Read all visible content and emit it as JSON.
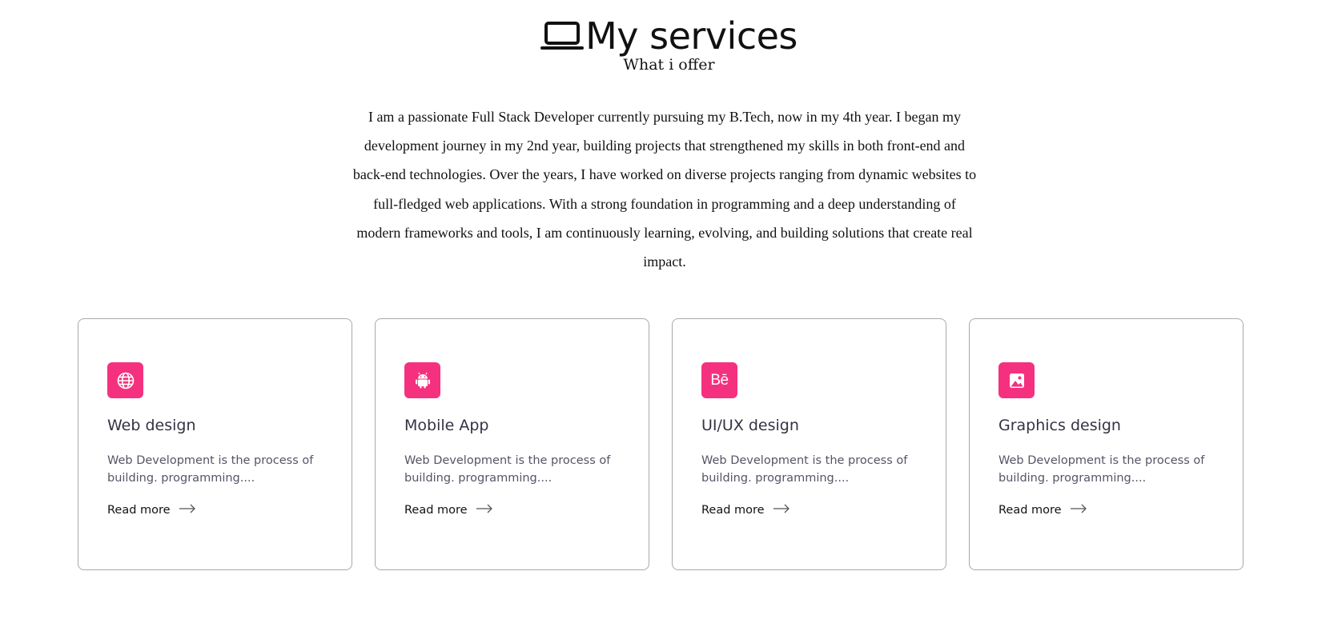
{
  "header": {
    "title": "My services",
    "subtitle": "What i offer",
    "title_icon": "laptop-icon"
  },
  "intro": {
    "text": "I am a passionate Full Stack Developer currently pursuing my B.Tech, now in my 4th year. I began my development journey in my 2nd year, building projects that strengthened my skills in both front-end and back-end technologies. Over the years, I have worked on diverse projects ranging from dynamic websites to full-fledged web applications. With a strong foundation in programming and a deep understanding of modern frameworks and tools, I am continuously learning, evolving, and building solutions that create real impact."
  },
  "colors": {
    "accent": "#f5317f",
    "card_border": "#a9a9a9",
    "text": "#111111"
  },
  "services": [
    {
      "icon": "globe-icon",
      "title": "Web design",
      "description": "Web Development is the process of building. programming....",
      "link_label": "Read more"
    },
    {
      "icon": "android-icon",
      "title": "Mobile App",
      "description": "Web Development is the process of building. programming....",
      "link_label": "Read more"
    },
    {
      "icon": "behance-icon",
      "icon_text": "Bē",
      "title": "UI/UX design",
      "description": "Web Development is the process of building. programming....",
      "link_label": "Read more"
    },
    {
      "icon": "image-icon",
      "title": "Graphics design",
      "description": "Web Development is the process of building. programming....",
      "link_label": "Read more"
    }
  ]
}
